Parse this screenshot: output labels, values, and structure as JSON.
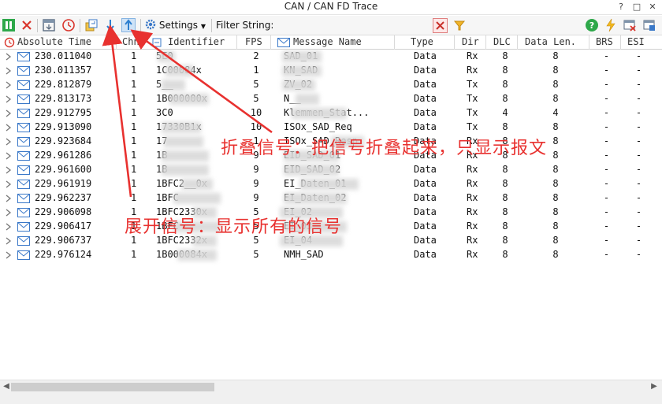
{
  "window": {
    "title": "CAN / CAN FD Trace",
    "controls": [
      "?",
      "□",
      "✕"
    ]
  },
  "toolbar": {
    "settings_label": "Settings",
    "filter_label": "Filter String:",
    "filter_value": ""
  },
  "columns": [
    "Absolute Time",
    "Chn",
    "Identifier",
    "FPS",
    "Message Name",
    "Type",
    "Dir",
    "DLC",
    "Data Len.",
    "BRS",
    "ESI"
  ],
  "rows": [
    {
      "time": "230.011040",
      "chn": "1",
      "id": "5E0",
      "fps": "2",
      "name": "SAD_01",
      "type": "Data",
      "dir": "Rx",
      "dlc": "8",
      "len": "8",
      "brs": "-",
      "esi": "-"
    },
    {
      "time": "230.011357",
      "chn": "1",
      "id": "1C00084x",
      "fps": "1",
      "name": "KN_SAD",
      "type": "Data",
      "dir": "Rx",
      "dlc": "8",
      "len": "8",
      "brs": "-",
      "esi": "-"
    },
    {
      "time": "229.812879",
      "chn": "1",
      "id": "5__",
      "fps": "5",
      "name": "ZV_02",
      "type": "Data",
      "dir": "Tx",
      "dlc": "8",
      "len": "8",
      "brs": "-",
      "esi": "-"
    },
    {
      "time": "229.813173",
      "chn": "1",
      "id": "1B000000x",
      "fps": "5",
      "name": "N__",
      "type": "Data",
      "dir": "Tx",
      "dlc": "8",
      "len": "8",
      "brs": "-",
      "esi": "-"
    },
    {
      "time": "229.912795",
      "chn": "1",
      "id": "3C0",
      "fps": "10",
      "name": "Klemmen_Stat...",
      "type": "Data",
      "dir": "Tx",
      "dlc": "4",
      "len": "4",
      "brs": "-",
      "esi": "-"
    },
    {
      "time": "229.913090",
      "chn": "1",
      "id": "17330B1x",
      "fps": "10",
      "name": "ISOx_SAD_Req",
      "type": "Data",
      "dir": "Tx",
      "dlc": "8",
      "len": "8",
      "brs": "-",
      "esi": "-"
    },
    {
      "time": "229.923684",
      "chn": "1",
      "id": "17",
      "fps": "1",
      "name": "ISOx_SAD_Resp",
      "type": "Data",
      "dir": "Rx",
      "dlc": "8",
      "len": "8",
      "brs": "-",
      "esi": "-"
    },
    {
      "time": "229.961286",
      "chn": "1",
      "id": "1B",
      "fps": "9",
      "name": "EID_SAD_01",
      "type": "Data",
      "dir": "Rx",
      "dlc": "8",
      "len": "8",
      "brs": "-",
      "esi": "-"
    },
    {
      "time": "229.961600",
      "chn": "1",
      "id": "1B",
      "fps": "9",
      "name": "EID_SAD_02",
      "type": "Data",
      "dir": "Rx",
      "dlc": "8",
      "len": "8",
      "brs": "-",
      "esi": "-"
    },
    {
      "time": "229.961919",
      "chn": "1",
      "id": "1BFC2__0x",
      "fps": "9",
      "name": "EI_Daten_01",
      "type": "Data",
      "dir": "Rx",
      "dlc": "8",
      "len": "8",
      "brs": "-",
      "esi": "-"
    },
    {
      "time": "229.962237",
      "chn": "1",
      "id": "1BFC",
      "fps": "9",
      "name": "EI_Daten_02",
      "type": "Data",
      "dir": "Rx",
      "dlc": "8",
      "len": "8",
      "brs": "-",
      "esi": "-"
    },
    {
      "time": "229.906098",
      "chn": "1",
      "id": "1BFC2330x",
      "fps": "5",
      "name": "EI_02",
      "type": "Data",
      "dir": "Rx",
      "dlc": "8",
      "len": "8",
      "brs": "-",
      "esi": "-"
    },
    {
      "time": "229.906417",
      "chn": "1",
      "id": "1BFC",
      "fps": "5",
      "name": "EI_03",
      "type": "Data",
      "dir": "Rx",
      "dlc": "8",
      "len": "8",
      "brs": "-",
      "esi": "-"
    },
    {
      "time": "229.906737",
      "chn": "1",
      "id": "1BFC2332x",
      "fps": "5",
      "name": "EI_04",
      "type": "Data",
      "dir": "Rx",
      "dlc": "8",
      "len": "8",
      "brs": "-",
      "esi": "-"
    },
    {
      "time": "229.976124",
      "chn": "1",
      "id": "1B000084x",
      "fps": "5",
      "name": "NMH_SAD",
      "type": "Data",
      "dir": "Rx",
      "dlc": "8",
      "len": "8",
      "brs": "-",
      "esi": "-"
    }
  ],
  "annotations": {
    "collapse": "折叠信号：把信号折叠起来，只显示报文",
    "expand": "展开信号：显示所有的信号"
  },
  "colors": {
    "annotation": "#e8312f",
    "envelope": "#3a78c8",
    "selected_arrow": "#2d7fd0"
  }
}
